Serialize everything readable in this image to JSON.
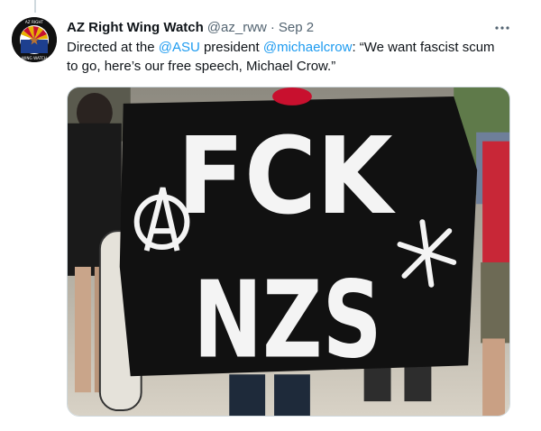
{
  "tweet": {
    "author_name": "AZ Right Wing Watch",
    "handle": "@az_rww",
    "separator": "·",
    "date": "Sep 2",
    "text_parts": [
      "Directed at the ",
      "@ASU",
      " president ",
      "@michaelcrow",
      ": “We want fascist scum to go, here’s our free speech, Michael Crow.”"
    ],
    "more_icon": "ellipsis-icon"
  },
  "media": {
    "banner_line1": "FCK",
    "banner_line2": "NZS"
  },
  "avatar_text": {
    "top": "AZ RIGHT",
    "bottom": "WING WATCH"
  },
  "colors": {
    "mention": "#1d9bf0",
    "muted": "#536471",
    "banner": "#111111"
  }
}
